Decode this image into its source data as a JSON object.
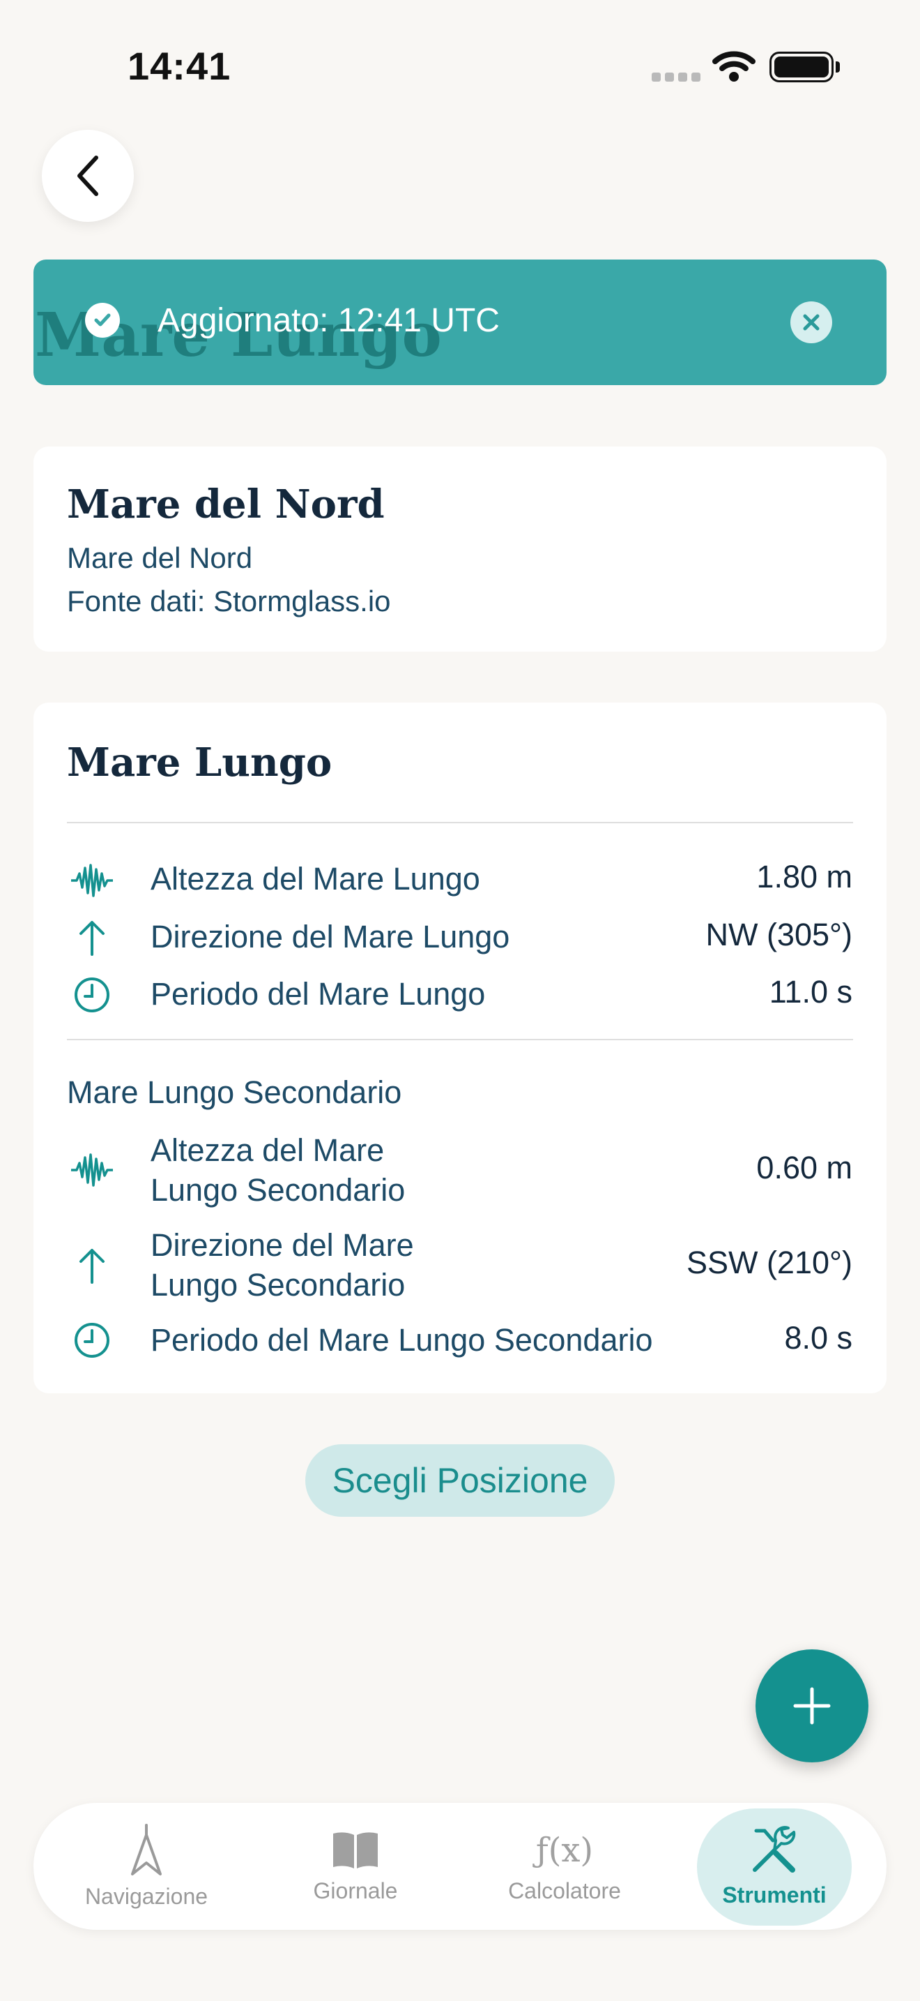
{
  "status_bar": {
    "time": "14:41"
  },
  "banner": {
    "behind_title": "Mare Lungo",
    "text": "Aggiornato: 12:41 UTC"
  },
  "location_card": {
    "title": "Mare del Nord",
    "subtitle": "Mare del Nord",
    "source": "Fonte dati: Stormglass.io"
  },
  "swell_card": {
    "title": "Mare Lungo",
    "primary": [
      {
        "label": "Altezza del Mare Lungo",
        "value": "1.80 m",
        "icon": "wave-icon"
      },
      {
        "label": "Direzione del Mare Lungo",
        "value": "NW (305°)",
        "icon": "arrow-up-icon"
      },
      {
        "label": "Periodo del Mare Lungo",
        "value": "11.0 s",
        "icon": "clock-icon"
      }
    ],
    "secondary_title": "Mare Lungo Secondario",
    "secondary": [
      {
        "label": "Altezza del Mare Lungo Secondario",
        "value": "0.60 m",
        "icon": "wave-icon"
      },
      {
        "label": "Direzione del Mare Lungo Secondario",
        "value": "SSW (210°)",
        "icon": "arrow-up-icon"
      },
      {
        "label": "Periodo del Mare Lungo Secondario",
        "value": "8.0 s",
        "icon": "clock-icon"
      }
    ]
  },
  "choose_button": "Scegli Posizione",
  "tabs": [
    {
      "label": "Navigazione",
      "icon": "navigation-icon",
      "active": false
    },
    {
      "label": "Giornale",
      "icon": "book-icon",
      "active": false
    },
    {
      "label": "Calcolatore",
      "icon": "function-icon",
      "icon_text": "ƒ(x)",
      "active": false
    },
    {
      "label": "Strumenti",
      "icon": "tools-icon",
      "active": true
    }
  ],
  "colors": {
    "accent": "#14918f",
    "banner": "#3aa8a8",
    "background": "#f9f7f4",
    "text": "#1d4a66"
  }
}
